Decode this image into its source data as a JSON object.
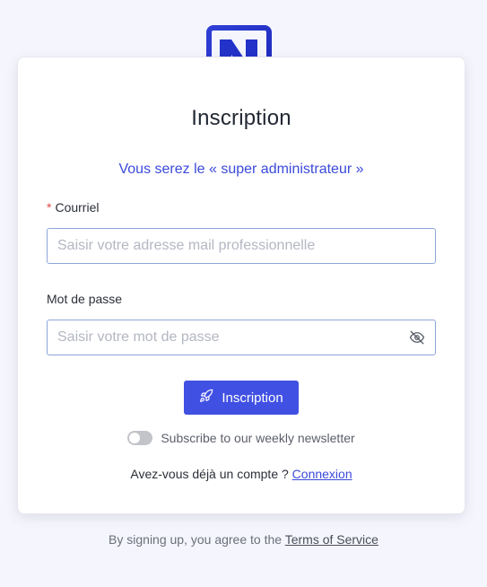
{
  "brand": {
    "logo_icon": "n-logo-icon",
    "accent_color": "#3b4ad9",
    "dot_color": "#f0183f"
  },
  "form": {
    "title": "Inscription",
    "subtitle": "Vous serez le « super administrateur »",
    "email": {
      "required_mark": "*",
      "label": "Courriel",
      "placeholder": "Saisir votre adresse mail professionnelle",
      "value": ""
    },
    "password": {
      "label": "Mot de passe",
      "placeholder": "Saisir votre mot de passe",
      "value": "",
      "toggle_icon": "eye-slash-icon"
    },
    "submit": {
      "icon": "rocket-icon",
      "label": "Inscription",
      "color": "#4050e3"
    },
    "newsletter": {
      "label": "Subscribe to our weekly newsletter",
      "checked": false
    },
    "login": {
      "prompt": "Avez-vous déjà un compte ?",
      "link": "Connexion"
    }
  },
  "footer": {
    "prefix": "By signing up, you agree to the",
    "link": "Terms of Service"
  }
}
